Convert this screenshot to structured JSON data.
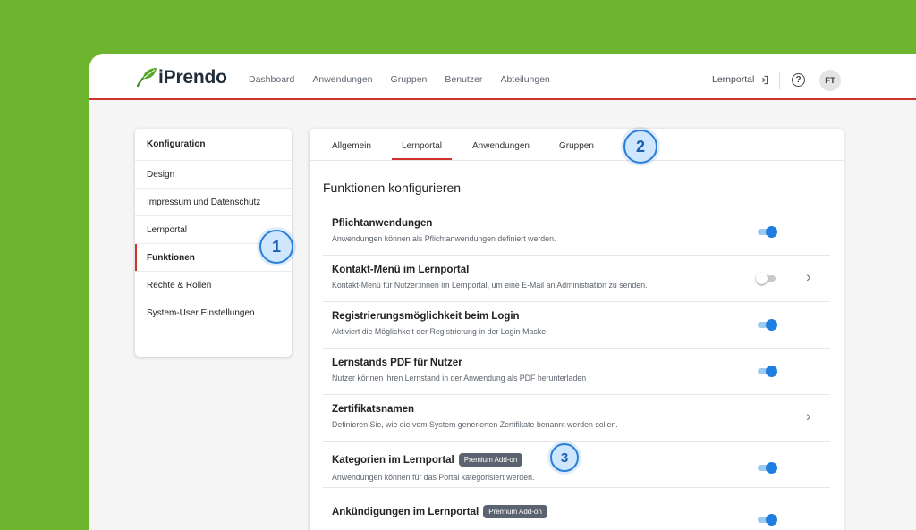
{
  "brand": {
    "name": "iPrendo",
    "accent": "#d0332d",
    "leaf_color": "#5aa82a"
  },
  "nav": {
    "items": [
      "Dashboard",
      "Anwendungen",
      "Gruppen",
      "Benutzer",
      "Abteilungen"
    ],
    "portal_link": "Lernportal",
    "help_icon": "?",
    "avatar_initials": "FT"
  },
  "sidebar": {
    "items": [
      {
        "label": "Konfiguration"
      },
      {
        "label": "Design"
      },
      {
        "label": "Impressum und Datenschutz"
      },
      {
        "label": "Lernportal"
      },
      {
        "label": "Funktionen"
      },
      {
        "label": "Rechte & Rollen"
      },
      {
        "label": "System-User Einstellungen"
      }
    ]
  },
  "main": {
    "tabs": [
      {
        "label": "Allgemein"
      },
      {
        "label": "Lernportal"
      },
      {
        "label": "Anwendungen"
      },
      {
        "label": "Gruppen"
      }
    ],
    "section_title": "Funktionen konfigurieren",
    "rows": [
      {
        "title": "Pflichtanwendungen",
        "desc": "Anwendungen können als Pflichtanwendungen definiert werden.",
        "toggle": "on"
      },
      {
        "title": "Kontakt-Menü im Lernportal",
        "desc": "Kontakt-Menü für Nutzer:innen im Lernportal, um eine E-Mail an Administration zu senden.",
        "toggle": "off"
      },
      {
        "title": "Registrierungsmöglichkeit beim Login",
        "desc": "Aktiviert die Möglichkeit der Registrierung in der Login-Maske.",
        "toggle": "on"
      },
      {
        "title": "Lernstands PDF für Nutzer",
        "desc": "Nutzer können ihren Lernstand in der Anwendung als PDF herunterladen",
        "toggle": "on"
      },
      {
        "title": "Zertifikatsnamen",
        "desc": "Definieren Sie, wie die vom System generierten Zertifikate benannt werden sollen."
      },
      {
        "title": "Kategorien im Lernportal",
        "badge": "Premium Add-on",
        "desc": "Anwendungen können für das Portal kategorisiert werden.",
        "toggle": "on"
      },
      {
        "title": "Ankündigungen im Lernportal",
        "badge": "Premium Add-on",
        "toggle": "on"
      }
    ]
  },
  "callouts": [
    "1",
    "2",
    "3"
  ]
}
